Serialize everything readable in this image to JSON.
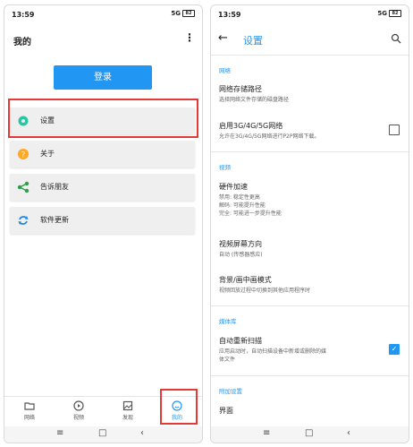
{
  "left": {
    "status": {
      "time": "13:59",
      "signal": "5G",
      "battery": "82"
    },
    "header": {
      "title": "我的"
    },
    "login_label": "登录",
    "menu": [
      {
        "label": "设置"
      },
      {
        "label": "关于"
      },
      {
        "label": "告诉朋友"
      },
      {
        "label": "软件更新"
      }
    ],
    "nav": [
      {
        "label": "网络"
      },
      {
        "label": "视频"
      },
      {
        "label": "发现"
      },
      {
        "label": "我的"
      }
    ]
  },
  "right": {
    "status": {
      "time": "13:59",
      "signal": "5G",
      "battery": "82"
    },
    "header": {
      "title": "设置"
    },
    "sections": {
      "network": "网络",
      "video": "视频",
      "media_library": "媒体库",
      "additional": "附加设置"
    },
    "prefs": {
      "network_storage": {
        "title": "网络存储路径",
        "summary": "选择网络文件存储的磁盘路径"
      },
      "mobile_network": {
        "title": "启用3G/4G/5G网络",
        "summary": "允许在3G/4G/5G网络进行P2P网络下载。"
      },
      "hw_accel": {
        "title": "硬件加速",
        "summary": "禁用: 稳定性更高\n解码: 可能提升性能\n完全: 可能进一步提升性能"
      },
      "orientation": {
        "title": "视频屏幕方向",
        "summary": "自动 (传感器感应)"
      },
      "pip": {
        "title": "背景/画中画模式",
        "summary": "视频回放过程中切换到其他应用程序时"
      },
      "rescan": {
        "title": "自动重新扫描",
        "summary": "应用启动时，自动扫描设备中新增或删除的媒\n体文件"
      },
      "interface": {
        "title": "界面"
      }
    },
    "check_mark": "✓"
  },
  "colors": {
    "accent": "#2196f3",
    "highlight": "#e53935"
  }
}
